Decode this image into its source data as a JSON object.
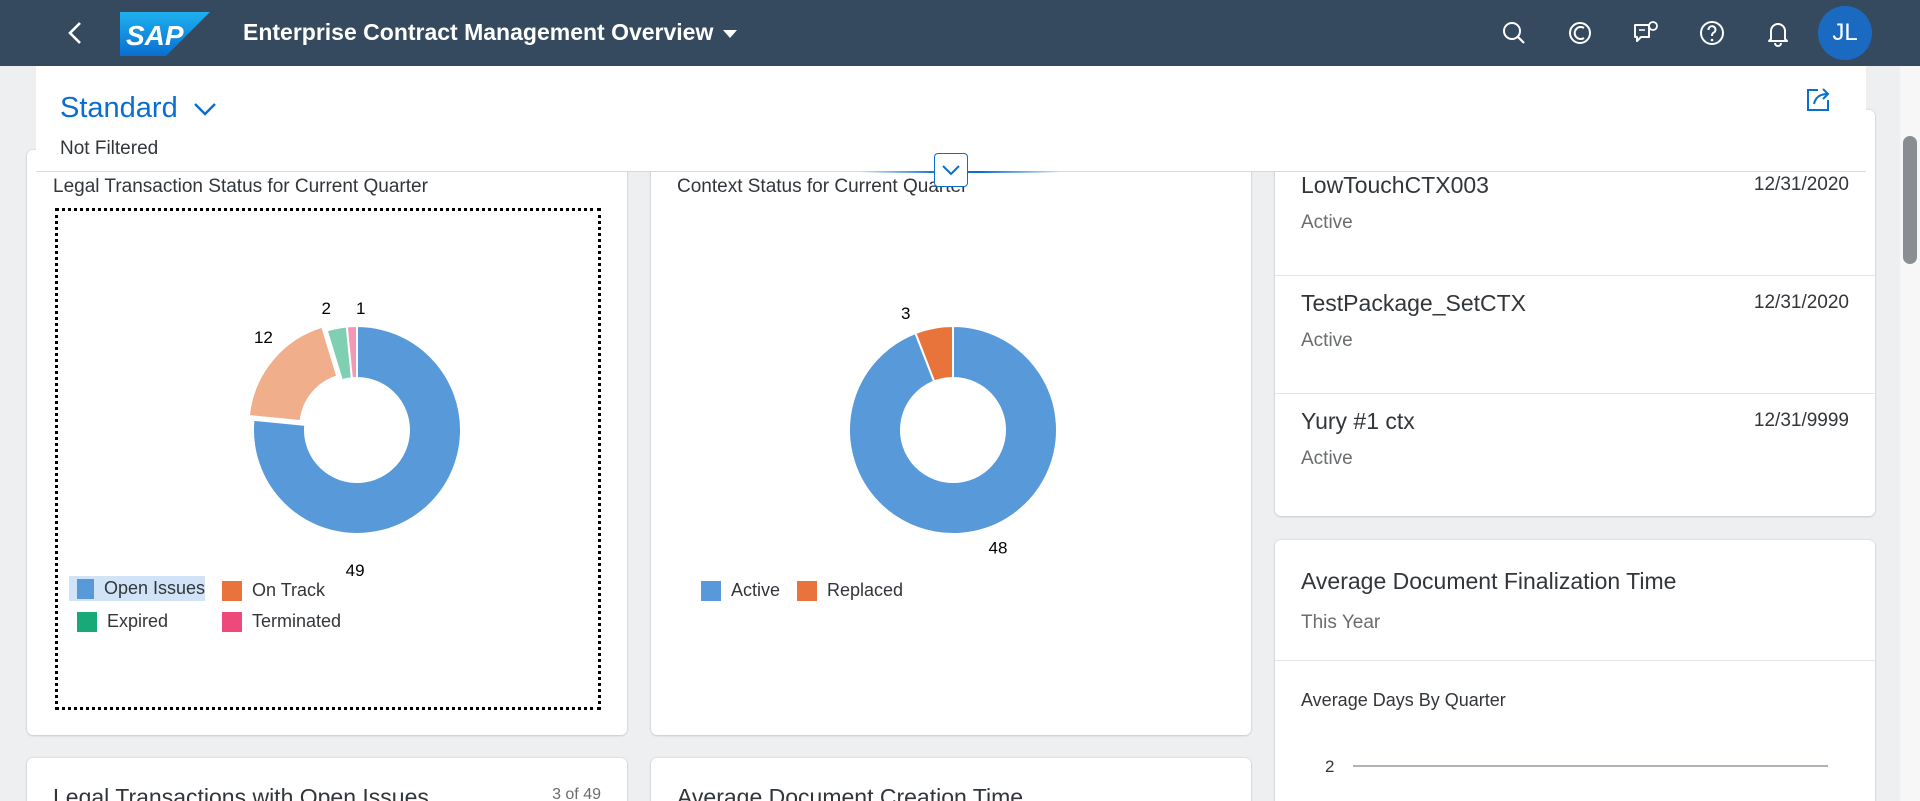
{
  "shell": {
    "logo_text": "SAP",
    "title": "Enterprise Contract Management Overview",
    "avatar_initials": "JL",
    "icons": [
      "search-icon",
      "copilot-icon",
      "feedback-icon",
      "help-icon",
      "notifications-icon"
    ]
  },
  "filter": {
    "variant": "Standard",
    "status": "Not Filtered"
  },
  "cards": {
    "legal": {
      "title": "Legal Transaction Status for Current Quarter",
      "legend": [
        {
          "label": "Open Issues",
          "color": "#5899da"
        },
        {
          "label": "On Track",
          "color": "#e8743b"
        },
        {
          "label": "Expired",
          "color": "#19a979"
        },
        {
          "label": "Terminated",
          "color": "#ed4a7b"
        }
      ]
    },
    "context": {
      "title": "Context Status for Current Quarter",
      "legend": [
        {
          "label": "Active",
          "color": "#5899da"
        },
        {
          "label": "Replaced",
          "color": "#e8743b"
        }
      ]
    },
    "contexts_list": [
      {
        "name": "LowTouchCTX003",
        "date": "12/31/2020",
        "status": "Active"
      },
      {
        "name": "TestPackage_SetCTX",
        "date": "12/31/2020",
        "status": "Active"
      },
      {
        "name": "Yury #1 ctx",
        "date": "12/31/9999",
        "status": "Active"
      }
    ],
    "avg_finalization": {
      "title": "Average Document Finalization Time",
      "subtitle": "This Year",
      "chart_title": "Average Days By Quarter",
      "axis_tick": "2"
    },
    "open_issues": {
      "title": "Legal Transactions with Open Issues",
      "count": "3 of 49"
    },
    "avg_creation": {
      "title": "Average Document Creation Time"
    }
  },
  "chart_data": [
    {
      "type": "pie",
      "title": "Legal Transaction Status for Current Quarter",
      "categories": [
        "Open Issues",
        "On Track",
        "Expired",
        "Terminated"
      ],
      "values": [
        49,
        12,
        2,
        1
      ],
      "colors": [
        "#5899da",
        "#f0ae8a",
        "#7fd0b3",
        "#f397b5"
      ],
      "legend": "bottom-left"
    },
    {
      "type": "pie",
      "title": "Context Status for Current Quarter",
      "categories": [
        "Active",
        "Replaced"
      ],
      "values": [
        48,
        3
      ],
      "colors": [
        "#5899da",
        "#e8743b"
      ],
      "legend": "bottom-left"
    }
  ]
}
